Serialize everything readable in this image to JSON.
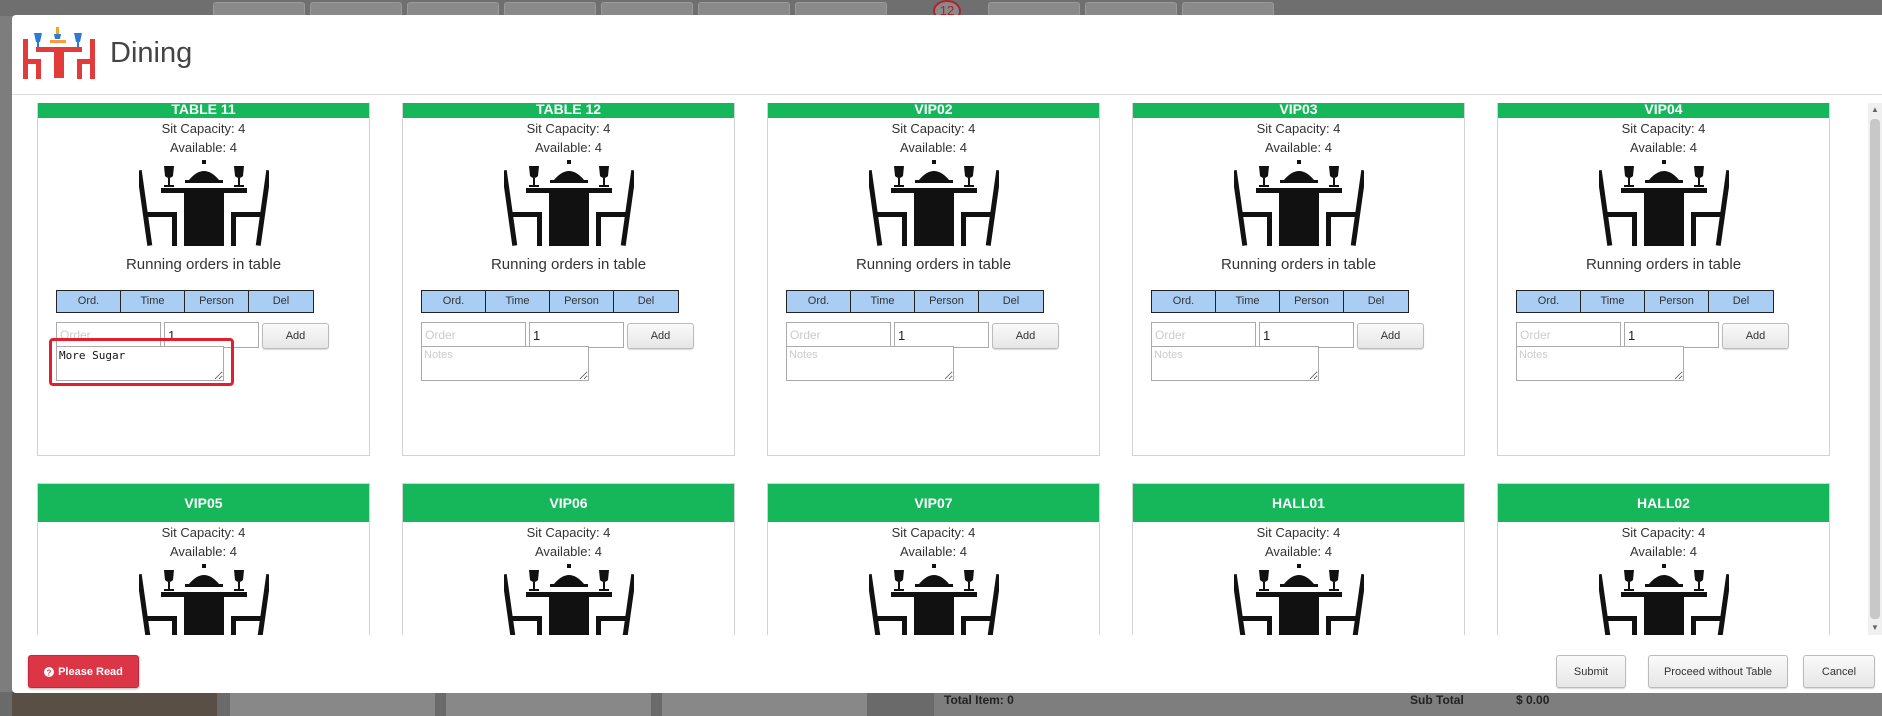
{
  "modal": {
    "title": "Dining",
    "logo_icon": "dining-table-logo-icon"
  },
  "card_labels": {
    "sit_capacity": "Sit Capacity: 4",
    "available": "Available: 4",
    "running_orders": "Running orders in table",
    "columns": [
      "Ord.",
      "Time",
      "Person",
      "Del"
    ],
    "order_placeholder": "Order",
    "qty_value": "1",
    "add_label": "Add",
    "notes_placeholder": "Notes"
  },
  "tables_row1": [
    {
      "name": "TABLE 11",
      "notes": "More Sugar"
    },
    {
      "name": "TABLE 12",
      "notes": ""
    },
    {
      "name": "VIP02",
      "notes": ""
    },
    {
      "name": "VIP03",
      "notes": ""
    },
    {
      "name": "VIP04",
      "notes": ""
    }
  ],
  "tables_row2": [
    {
      "name": "VIP05"
    },
    {
      "name": "VIP06"
    },
    {
      "name": "VIP07"
    },
    {
      "name": "HALL01"
    },
    {
      "name": "HALL02"
    }
  ],
  "footer": {
    "please_read": "Please Read",
    "submit": "Submit",
    "proceed": "Proceed without Table",
    "cancel": "Cancel"
  },
  "background": {
    "badge": "12",
    "total_item": "Total Item: 0",
    "sub_total_label": "Sub Total",
    "sub_total_value": "$ 0.00"
  },
  "colors": {
    "header_green": "#16b65a",
    "column_blue": "#a9cdf3",
    "danger": "#dc3545",
    "highlight": "#e0202f"
  }
}
